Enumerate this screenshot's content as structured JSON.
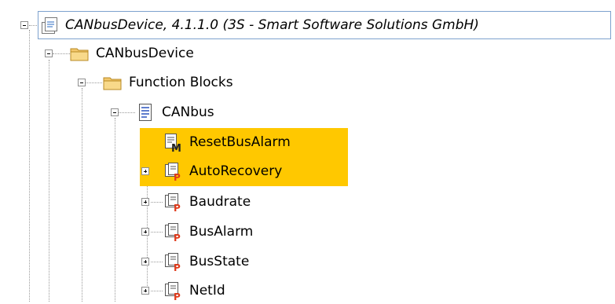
{
  "tree": {
    "root": {
      "label": "CANbusDevice, 4.1.1.0 (3S - Smart Software Solutions GmbH)",
      "icon": "page-icon",
      "expanded": true,
      "selected": true
    },
    "device": {
      "label": "CANbusDevice",
      "icon": "folder-icon",
      "expanded": true
    },
    "function_blocks": {
      "label": "Function Blocks",
      "icon": "folder-icon",
      "expanded": true
    },
    "canbus": {
      "label": "CANbus",
      "icon": "document-icon",
      "expanded": true
    },
    "children": [
      {
        "label": "ResetBusAlarm",
        "icon": "method-icon",
        "highlighted": true,
        "expandable": false
      },
      {
        "label": "AutoRecovery",
        "icon": "property-icon",
        "highlighted": true,
        "expandable": true
      },
      {
        "label": "Baudrate",
        "icon": "property-icon",
        "highlighted": false,
        "expandable": true
      },
      {
        "label": "BusAlarm",
        "icon": "property-icon",
        "highlighted": false,
        "expandable": true
      },
      {
        "label": "BusState",
        "icon": "property-icon",
        "highlighted": false,
        "expandable": true
      },
      {
        "label": "NetId",
        "icon": "property-icon",
        "highlighted": false,
        "expandable": true
      }
    ]
  },
  "colors": {
    "highlight": "#ffc800",
    "selection_border": "#7da2ce",
    "folder": "#f2c76b",
    "property_p": "#e03a1a"
  }
}
